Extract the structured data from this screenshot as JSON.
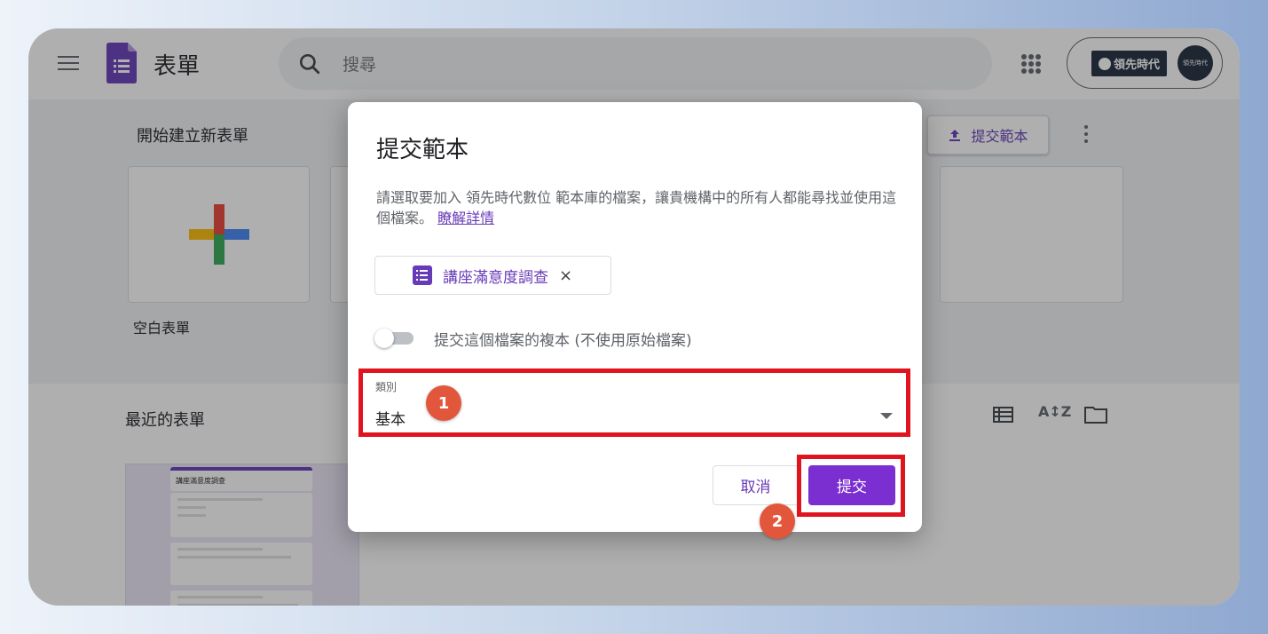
{
  "header": {
    "app_title": "表單",
    "search_placeholder": "搜尋",
    "brand_text": "領先時代",
    "avatar_text": "領先時代"
  },
  "gallery": {
    "title": "開始建立新表單",
    "submit_template_label": "提交範本",
    "blank_form_label": "空白表單"
  },
  "recent": {
    "title": "最近的表單",
    "thumb_title": "講座滿意度調查"
  },
  "dialog": {
    "title": "提交範本",
    "description": "請選取要加入 領先時代數位 範本庫的檔案，讓貴機構中的所有人都能尋找並使用這個檔案。",
    "learn_more": "瞭解詳情",
    "file_chip_label": "講座滿意度調查",
    "file_chip_close": "×",
    "copy_toggle_label": "提交這個檔案的複本 (不使用原始檔案)",
    "copy_toggle_on": false,
    "category_caption": "類別",
    "category_value": "基本",
    "cancel_label": "取消",
    "submit_label": "提交"
  },
  "annotations": {
    "step1": "1",
    "step2": "2"
  },
  "colors": {
    "accent": "#673ab7",
    "submit_button": "#7b2fd0",
    "annotation_red": "#e0141e",
    "badge_orange": "#e2573c"
  }
}
